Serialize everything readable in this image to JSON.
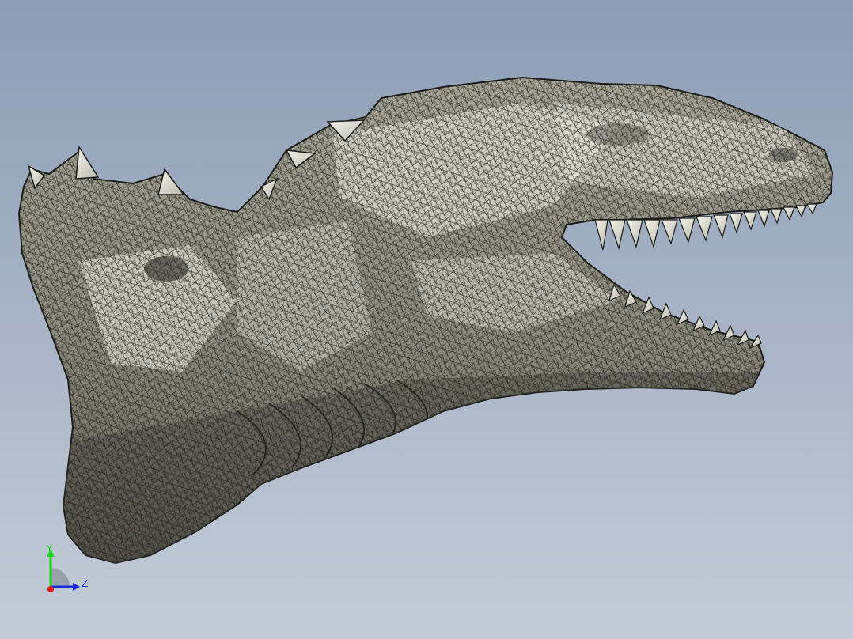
{
  "viewport": {
    "model": "dinosaur-head-mesh",
    "display_mode": "shaded-with-edges",
    "background": {
      "top": "#8c9db4",
      "bottom": "#c4ccd8"
    }
  },
  "triad": {
    "y_label": "Y",
    "z_label": "Z",
    "colors": {
      "x": "#e01818",
      "y": "#1fd01f",
      "z": "#1a2bdc"
    }
  }
}
